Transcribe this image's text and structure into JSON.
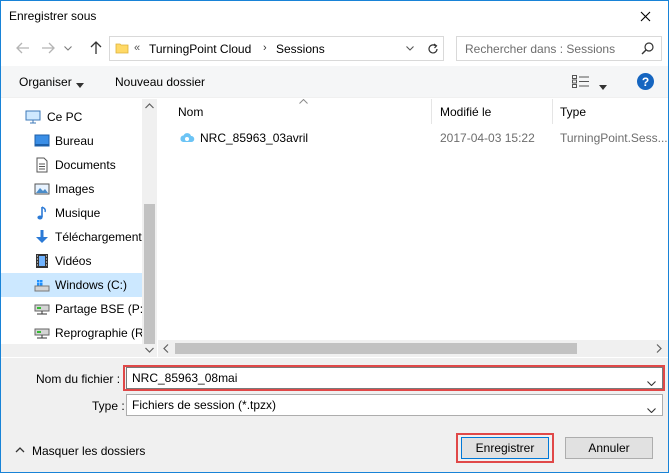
{
  "window": {
    "title": "Enregistrer sous"
  },
  "nav": {
    "address": {
      "overflow_chevron": "«",
      "crumbs": [
        "TurningPoint Cloud",
        "Sessions"
      ],
      "separator": "›"
    },
    "search_placeholder": "Rechercher dans : Sessions"
  },
  "toolbar": {
    "organize_label": "Organiser",
    "new_folder_label": "Nouveau dossier",
    "help_label": "?"
  },
  "sidebar": {
    "items": [
      {
        "label": "Ce PC",
        "icon": "computer-icon"
      },
      {
        "label": "Bureau",
        "icon": "desktop-icon"
      },
      {
        "label": "Documents",
        "icon": "documents-icon"
      },
      {
        "label": "Images",
        "icon": "images-icon"
      },
      {
        "label": "Musique",
        "icon": "music-icon"
      },
      {
        "label": "Téléchargements",
        "icon": "download-icon"
      },
      {
        "label": "Vidéos",
        "icon": "videos-icon"
      },
      {
        "label": "Windows (C:)",
        "icon": "drive-icon",
        "selected": true
      },
      {
        "label": "Partage BSE (P:)",
        "icon": "network-drive-icon"
      },
      {
        "label": "Reprographie (R:",
        "icon": "network-drive-icon"
      }
    ]
  },
  "filelist": {
    "columns": [
      "Nom",
      "Modifié le",
      "Type"
    ],
    "rows": [
      {
        "name": "NRC_85963_03avril",
        "modified": "2017-04-03 15:22",
        "type": "TurningPoint.Sess..."
      }
    ]
  },
  "form": {
    "filename_label": "Nom du fichier :",
    "filename_value": "NRC_85963_08mai",
    "type_label": "Type :",
    "type_value": "Fichiers de session (*.tpzx)"
  },
  "footer": {
    "hide_folders_label": "Masquer les dossiers",
    "save_label": "Enregistrer",
    "cancel_label": "Annuler"
  },
  "colors": {
    "accent": "#0078d7",
    "highlight": "#e04848",
    "selected_bg": "#cce8ff",
    "help_icon": "#1565c0"
  }
}
